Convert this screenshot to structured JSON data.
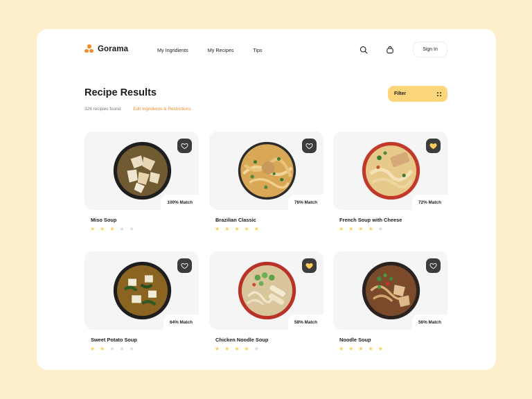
{
  "brand": {
    "name": "Gorama",
    "accent": "#F28C28"
  },
  "nav": [
    {
      "label": "My Ingridients"
    },
    {
      "label": "My Recipes"
    },
    {
      "label": "Tips"
    }
  ],
  "header": {
    "search_icon": "search-icon",
    "bag_icon": "bag-icon",
    "signin_label": "Sign In"
  },
  "page": {
    "title": "Recipe Results",
    "count": "326 recipies found",
    "edit_link": "Edit Ingridients & Restrictions",
    "filter_label": "Filter"
  },
  "colors": {
    "background": "#FEEFCC",
    "filter": "#FDD57A",
    "star": "#FDCB5C",
    "heart_active": "#FDCB5C"
  },
  "recipes": [
    {
      "name": "Miso Soup",
      "match": "100% Match",
      "rating": 3,
      "favorite": false
    },
    {
      "name": "Brazilian Classic",
      "match": "76% Match",
      "rating": 5,
      "favorite": false
    },
    {
      "name": "French Soup with Cheese",
      "match": "72% Match",
      "rating": 4,
      "favorite": true
    },
    {
      "name": "Sweet Potato Soup",
      "match": "64% Match",
      "rating": 2,
      "favorite": false
    },
    {
      "name": "Chicken Noodle Soup",
      "match": "58% Match",
      "rating": 4,
      "favorite": true
    },
    {
      "name": "Noodle Soup",
      "match": "56% Match",
      "rating": 5,
      "favorite": false
    }
  ]
}
